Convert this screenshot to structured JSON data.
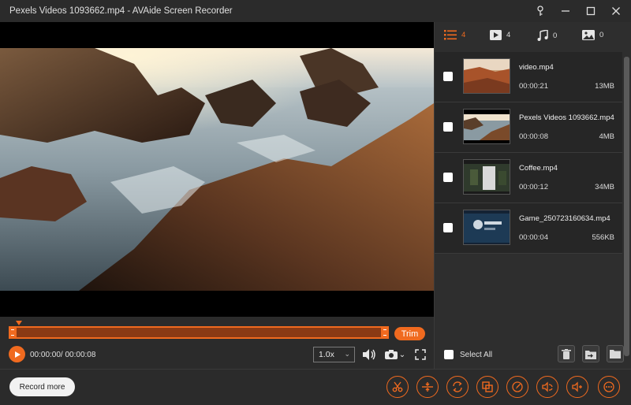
{
  "window": {
    "title": "Pexels Videos 1093662.mp4   -   AVAide Screen Recorder"
  },
  "player": {
    "trim_label": "Trim",
    "timecode": "00:00:00/ 00:00:08",
    "speed": "1.0x",
    "progress": 0
  },
  "tabs": [
    {
      "icon": "list-icon",
      "count": "4"
    },
    {
      "icon": "video-icon",
      "count": "4"
    },
    {
      "icon": "music-icon",
      "count": "0"
    },
    {
      "icon": "image-icon",
      "count": "0"
    }
  ],
  "files": [
    {
      "name": "video.mp4",
      "duration": "00:00:21",
      "size": "13MB"
    },
    {
      "name": "Pexels Videos 1093662.mp4",
      "duration": "00:00:08",
      "size": "4MB"
    },
    {
      "name": "Coffee.mp4",
      "duration": "00:00:12",
      "size": "34MB"
    },
    {
      "name": "Game_250723160634.mp4",
      "duration": "00:00:04",
      "size": "556KB"
    }
  ],
  "panel": {
    "select_all": "Select All"
  },
  "bottom": {
    "record_more": "Record more"
  },
  "colors": {
    "accent": "#f06a1f",
    "background": "#2b2b2b"
  }
}
